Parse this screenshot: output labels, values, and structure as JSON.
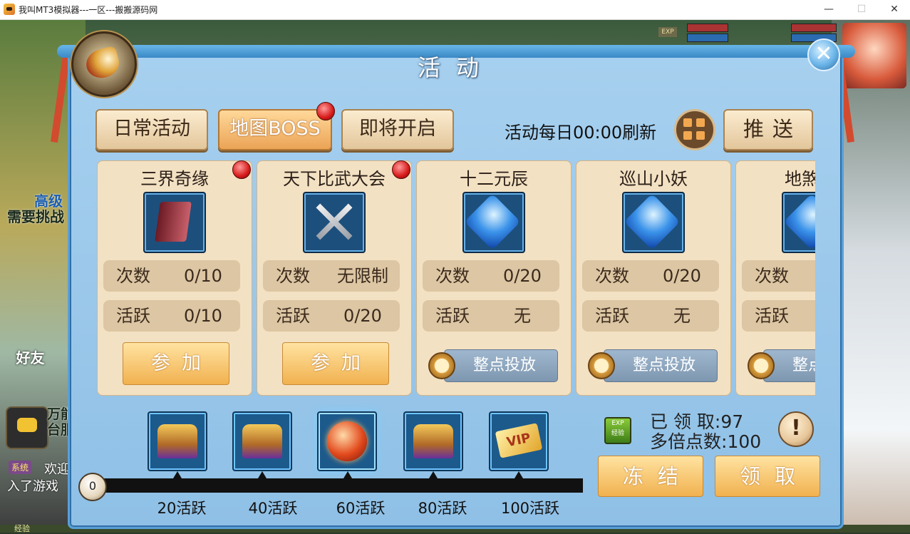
{
  "window": {
    "title": "我叫MT3模拟器---一区---搬搬源码网",
    "minimize": "—",
    "maximize": "☐",
    "close": "✕"
  },
  "background": {
    "left_text_1": "高级",
    "left_text_2": "需要挑战",
    "friend": "好友",
    "side_text_1": "万能",
    "side_text_2": "台服",
    "system_tag": "系统",
    "system_msg_1": "欢迎",
    "system_msg_2": "入了游戏",
    "exp_tag": "EXP",
    "bottom_label": "经验"
  },
  "panel": {
    "title": "活动",
    "close_icon": "close-icon"
  },
  "tabs": [
    {
      "label": "日常活动",
      "active": false,
      "badge": false
    },
    {
      "label": "地图BOSS",
      "active": true,
      "badge": true
    },
    {
      "label": "即将开启",
      "active": false,
      "badge": false
    }
  ],
  "toolbar": {
    "refresh_text": "活动每日00:00刷新",
    "grid_icon": "grid-icon",
    "push_label": "推送"
  },
  "cards": [
    {
      "name": "三界奇缘",
      "icon": "book-icon",
      "badge": true,
      "count_label": "次数",
      "count_value": "0/10",
      "active_label": "活跃",
      "active_value": "0/10",
      "action": "参加",
      "action_type": "join"
    },
    {
      "name": "天下比武大会",
      "icon": "crossed-swords-icon",
      "badge": true,
      "count_label": "次数",
      "count_value": "无限制",
      "active_label": "活跃",
      "active_value": "0/20",
      "action": "参加",
      "action_type": "join"
    },
    {
      "name": "十二元辰",
      "icon": "blue-gem-icon",
      "badge": false,
      "count_label": "次数",
      "count_value": "0/20",
      "active_label": "活跃",
      "active_value": "无",
      "action": "整点投放",
      "action_type": "drop"
    },
    {
      "name": "巡山小妖",
      "icon": "blue-gem-icon",
      "badge": false,
      "count_label": "次数",
      "count_value": "0/20",
      "active_label": "活跃",
      "active_value": "无",
      "action": "整点投放",
      "action_type": "drop"
    },
    {
      "name": "地煞",
      "icon": "blue-gem-icon",
      "badge": false,
      "count_label": "次数",
      "count_value": "",
      "active_label": "活跃",
      "active_value": "",
      "action": "整点",
      "action_type": "drop"
    }
  ],
  "progress": {
    "current": "0",
    "milestones": [
      {
        "label": "20活跃",
        "reward_icon": "treasure-chest-icon"
      },
      {
        "label": "40活跃",
        "reward_icon": "treasure-chest-icon"
      },
      {
        "label": "60活跃",
        "reward_icon": "red-orb-icon"
      },
      {
        "label": "80活跃",
        "reward_icon": "treasure-chest-icon"
      },
      {
        "label": "100活跃",
        "reward_icon": "vip-card-icon"
      }
    ],
    "vip_text": "VIP"
  },
  "claim": {
    "exp_badge": "EXP\n经验",
    "claimed_label": "已 领 取:",
    "claimed_value": "97",
    "multiplier_label": "多倍点数:",
    "multiplier_value": "100",
    "info_symbol": "!",
    "freeze_label": "冻结",
    "claim_label": "领取"
  }
}
